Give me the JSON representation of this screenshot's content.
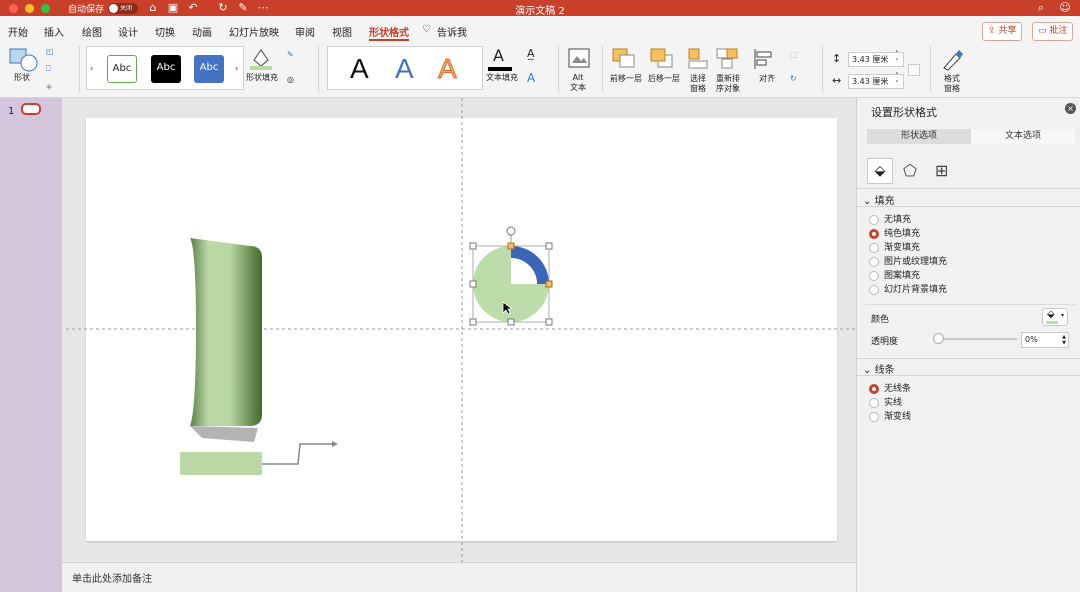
{
  "window": {
    "autosave_label": "自动保存",
    "autosave_toggle": "关闭",
    "title": "演示文稿 2"
  },
  "tabs": [
    "开始",
    "插入",
    "绘图",
    "设计",
    "切换",
    "动画",
    "幻灯片放映",
    "审阅",
    "视图",
    "形状格式",
    "告诉我"
  ],
  "active_tab": "形状格式",
  "header_buttons": {
    "share": "共享",
    "comment": "批注"
  },
  "ribbon": {
    "shape_label": "形状",
    "style_swatches": [
      "Abc",
      "Abc",
      "Abc"
    ],
    "shape_fill_label": "形状填充",
    "wordart_letters": [
      "A",
      "A",
      "A"
    ],
    "text_fill_label": "文本填充",
    "alt_text_label": "Alt\n文本",
    "bring_forward": "前移一层",
    "send_backward": "后移一层",
    "selection_pane": "选择\n窗格",
    "reorder": "重新排\n序对象",
    "align": "对齐",
    "height_value": "3.43 厘米",
    "width_value": "3.43 厘米",
    "format_pane": "格式\n窗格"
  },
  "slides": {
    "current_number": "1"
  },
  "notes_placeholder": "单击此处添加备注",
  "format_panel": {
    "title": "设置形状格式",
    "tabs": [
      "形状选项",
      "文本选项"
    ],
    "fill_section": "填充",
    "fill_options": [
      "无填充",
      "纯色填充",
      "渐变填充",
      "图片或纹理填充",
      "图案填充",
      "幻灯片背景填充"
    ],
    "fill_selected": 1,
    "color_label": "颜色",
    "transparency_label": "透明度",
    "transparency_value": "0%",
    "line_section": "线条",
    "line_options": [
      "无线条",
      "实线",
      "渐变线"
    ],
    "line_selected": 0
  },
  "colors": {
    "accent": "#c8402a",
    "pie_fill": "#bcdcaa",
    "pie_arc": "#3a65b8",
    "tab_fill": "#b9d8a3",
    "tab_dark": "#3f6b2e"
  }
}
